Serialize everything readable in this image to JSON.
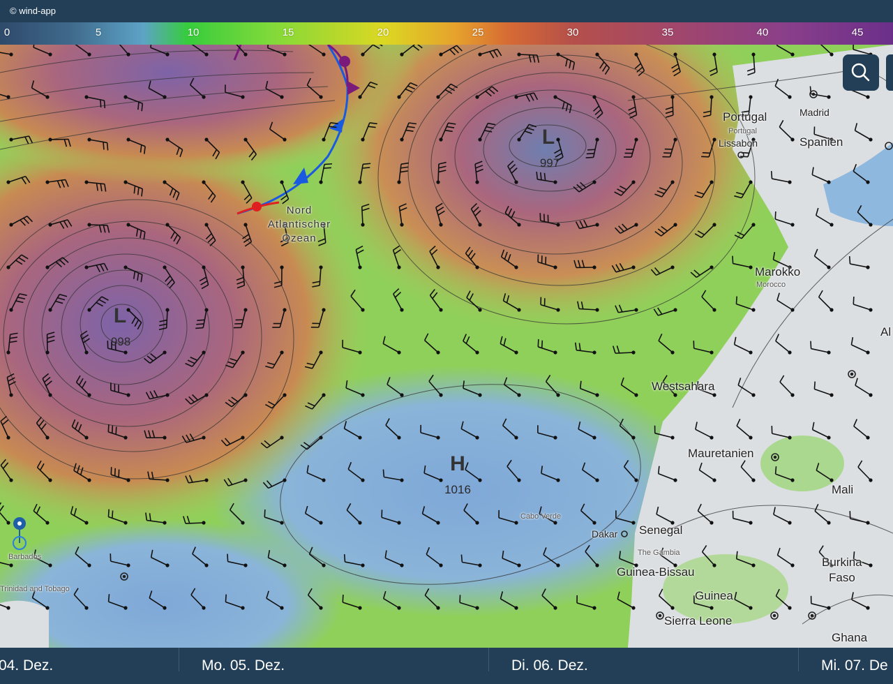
{
  "header": {
    "credit": "© wind-app"
  },
  "wind_scale": {
    "ticks": [
      "0",
      "5",
      "10",
      "15",
      "20",
      "25",
      "30",
      "35",
      "40",
      "45"
    ]
  },
  "map": {
    "countries": {
      "portugal": "Portugal",
      "spanien": "Spanien",
      "marokko": "Marokko",
      "westsahara": "Westsahara",
      "mauretanien": "Mauretanien",
      "mali": "Mali",
      "senegal": "Senegal",
      "guinea_bissau": "Guinea-Bissau",
      "guinea": "Guinea",
      "sierra_leone": "Sierra Leone",
      "burkina_faso_1": "Burkina",
      "burkina_faso_2": "Faso",
      "ghana": "Ghana",
      "algeria_partial": "Al"
    },
    "cities": {
      "madrid": "Madrid",
      "lissabon": "Lissabon",
      "dakar": "Dakar"
    },
    "small_labels": {
      "portugal_small": "Portugal",
      "marokko_small": "Morocco",
      "barbados": "Barbados",
      "trinidad": "Trinidad and Tobago",
      "cabo_verde": "Cabo Verde",
      "the_gambia": "The Gambia"
    },
    "ocean_label": [
      "Nord",
      "Atlantischer",
      "Ozean"
    ],
    "pressure_systems": [
      {
        "type": "L",
        "value": "997"
      },
      {
        "type": "L",
        "value": "998"
      },
      {
        "type": "H",
        "value": "1016"
      }
    ]
  },
  "search_icon": "search-icon",
  "timeline": {
    "days": [
      "04. Dez.",
      "Mo. 05. Dez.",
      "Di. 06. Dez.",
      "Mi. 07. De"
    ]
  }
}
